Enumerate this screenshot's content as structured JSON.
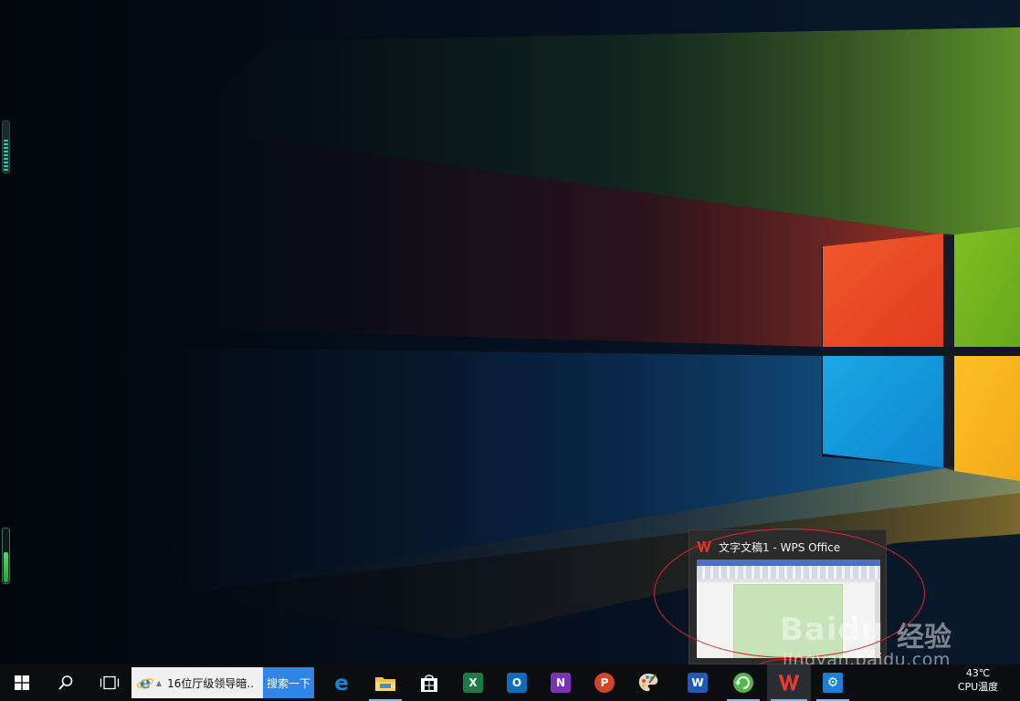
{
  "preview": {
    "title": "文字文稿1 - WPS Office"
  },
  "taskbar": {
    "search_text": "16位厅级领导暗...",
    "search_button": "搜索一下",
    "apps": [
      {
        "name": "edge",
        "glyph": "e"
      },
      {
        "name": "file-explorer",
        "glyph": ""
      },
      {
        "name": "store",
        "glyph": ""
      },
      {
        "name": "excel",
        "glyph": "X"
      },
      {
        "name": "outlook",
        "glyph": "O"
      },
      {
        "name": "onenote",
        "glyph": "N"
      },
      {
        "name": "powerpoint",
        "glyph": "P"
      },
      {
        "name": "paint",
        "glyph": ""
      },
      {
        "name": "word",
        "glyph": "W"
      },
      {
        "name": "green-app",
        "glyph": ""
      },
      {
        "name": "wps",
        "glyph": "W"
      },
      {
        "name": "settings",
        "glyph": "⚙"
      }
    ]
  },
  "tray": {
    "cpu_temp": "43℃",
    "cpu_label": "CPU温度"
  },
  "watermark": {
    "brand": "Baidu",
    "cn": "经验",
    "url": "jingyan.baidu.com"
  }
}
